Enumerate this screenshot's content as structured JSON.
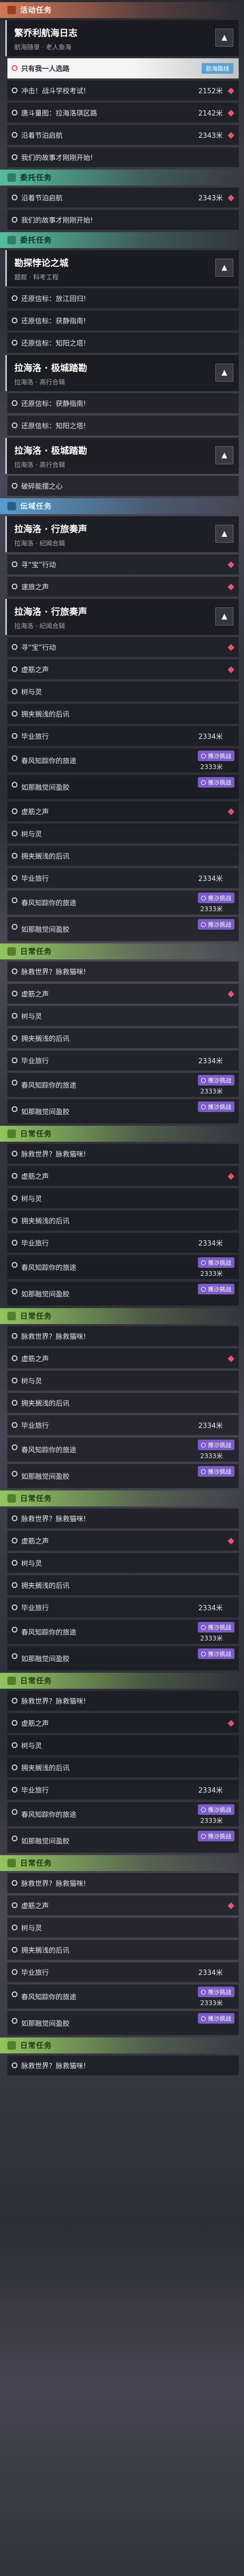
{
  "badges": {
    "navigate": "航海路线",
    "challenge": "推沙挑战"
  },
  "feed": [
    {
      "k": "sec",
      "type": "event",
      "label": "活动任务"
    },
    {
      "k": "head",
      "title": "繁乔利航海日志",
      "sub": "航海随录 · 老人鱼海"
    },
    {
      "k": "row",
      "label": "只有我一人选路",
      "hl": true,
      "badge": "航海路线"
    },
    {
      "k": "row",
      "label": "冲击！战斗学校考试!",
      "dist": "2152米",
      "pin": true
    },
    {
      "k": "row",
      "label": "唐斗量图：拉海洛琪区路",
      "dist": "2142米",
      "pin": true
    },
    {
      "k": "row",
      "label": "沿着节泊启航",
      "dist": "2343米",
      "pin": true
    },
    {
      "k": "row",
      "label": "我们的故事才刚刚开始!"
    },
    {
      "k": "sec",
      "type": "comm",
      "label": "委托任务"
    },
    {
      "k": "row",
      "label": "沿着节泊启航",
      "dist": "2343米",
      "pin": true
    },
    {
      "k": "row",
      "label": "我们的故事才刚刚开始!"
    },
    {
      "k": "sec",
      "type": "comm",
      "label": "委托任务"
    },
    {
      "k": "head",
      "title": "勘探悖论之城",
      "sub": "题叙 · 科考工程"
    },
    {
      "k": "row",
      "label": "还原信标：放江回归!"
    },
    {
      "k": "row",
      "label": "还原信标：获静指南!"
    },
    {
      "k": "row",
      "label": "还原信标：知阳之塔!"
    },
    {
      "k": "head",
      "title": "拉海洛 · 极城踏勘",
      "sub": "拉海洛 · 高行合辑"
    },
    {
      "k": "row",
      "label": "还原信标：获静指南!"
    },
    {
      "k": "row",
      "label": "还原信标：知阳之塔!"
    },
    {
      "k": "head",
      "title": "拉海洛 · 极城踏勘",
      "sub": "拉海洛 · 高行合辑"
    },
    {
      "k": "row",
      "label": "破碎能摆之心"
    },
    {
      "k": "sec",
      "type": "invite",
      "label": "伝域任务"
    },
    {
      "k": "head",
      "title": "拉海洛 · 行旅奏声",
      "sub": "拉海洛 · 纪闻合辑"
    },
    {
      "k": "row",
      "label": "寻“宝”行动",
      "pin": true
    },
    {
      "k": "row",
      "label": "速旅之声",
      "pin": true
    },
    {
      "k": "head",
      "title": "拉海洛 · 行旅奏声",
      "sub": "拉海洛 · 纪闻合辑"
    },
    {
      "k": "row",
      "label": "寻“宝”行动",
      "pin": true
    },
    {
      "k": "row",
      "label": "虚筋之声",
      "pin": true
    },
    {
      "k": "row",
      "label": "树与灵"
    },
    {
      "k": "row",
      "label": "拥夹搁浅的后讯"
    },
    {
      "k": "row",
      "label": "毕业旅行",
      "dist": "2334米"
    },
    {
      "k": "row",
      "label": "春风知踪你的旅途",
      "chal": true,
      "dist": "2333米"
    },
    {
      "k": "row",
      "label": "如那融觉间盈胶",
      "chal": true
    },
    {
      "k": "row",
      "label": "虚筋之声",
      "pin": true
    },
    {
      "k": "row",
      "label": "树与灵"
    },
    {
      "k": "row",
      "label": "拥夹搁浅的后讯"
    },
    {
      "k": "row",
      "label": "毕业旅行",
      "dist": "2334米"
    },
    {
      "k": "row",
      "label": "春风知踪你的旅途",
      "chal": true,
      "dist": "2333米"
    },
    {
      "k": "row",
      "label": "如那融觉间盈胶",
      "chal": true
    },
    {
      "k": "sec",
      "type": "daily",
      "label": "日常任务"
    },
    {
      "k": "row",
      "label": "脉救世界？脉救猫咪!"
    },
    {
      "k": "row",
      "label": "虚筋之声",
      "pin": true
    },
    {
      "k": "row",
      "label": "树与灵"
    },
    {
      "k": "row",
      "label": "拥夹搁浅的后讯"
    },
    {
      "k": "row",
      "label": "毕业旅行",
      "dist": "2334米"
    },
    {
      "k": "row",
      "label": "春风知踪你的旅途",
      "chal": true,
      "dist": "2333米"
    },
    {
      "k": "row",
      "label": "如那融觉间盈胶",
      "chal": true
    },
    {
      "k": "sec",
      "type": "daily",
      "label": "日常任务"
    },
    {
      "k": "row",
      "label": "脉救世界？脉救猫咪!"
    },
    {
      "k": "row",
      "label": "虚筋之声",
      "pin": true
    },
    {
      "k": "row",
      "label": "树与灵"
    },
    {
      "k": "row",
      "label": "拥夹搁浅的后讯"
    },
    {
      "k": "row",
      "label": "毕业旅行",
      "dist": "2334米"
    },
    {
      "k": "row",
      "label": "春风知踪你的旅途",
      "chal": true,
      "dist": "2333米"
    },
    {
      "k": "row",
      "label": "如那融觉间盈胶",
      "chal": true
    },
    {
      "k": "sec",
      "type": "daily",
      "label": "日常任务"
    },
    {
      "k": "row",
      "label": "脉救世界？脉救猫咪!"
    },
    {
      "k": "row",
      "label": "虚筋之声",
      "pin": true
    },
    {
      "k": "row",
      "label": "树与灵"
    },
    {
      "k": "row",
      "label": "拥夹搁浅的后讯"
    },
    {
      "k": "row",
      "label": "毕业旅行",
      "dist": "2334米"
    },
    {
      "k": "row",
      "label": "春风知踪你的旅途",
      "chal": true,
      "dist": "2333米"
    },
    {
      "k": "row",
      "label": "如那融觉间盈胶",
      "chal": true
    },
    {
      "k": "sec",
      "type": "daily",
      "label": "日常任务"
    },
    {
      "k": "row",
      "label": "脉救世界？脉救猫咪!"
    },
    {
      "k": "row",
      "label": "虚筋之声",
      "pin": true
    },
    {
      "k": "row",
      "label": "树与灵"
    },
    {
      "k": "row",
      "label": "拥夹搁浅的后讯"
    },
    {
      "k": "row",
      "label": "毕业旅行",
      "dist": "2334米"
    },
    {
      "k": "row",
      "label": "春风知踪你的旅途",
      "chal": true,
      "dist": "2333米"
    },
    {
      "k": "row",
      "label": "如那融觉间盈胶",
      "chal": true
    },
    {
      "k": "sec",
      "type": "daily",
      "label": "日常任务"
    },
    {
      "k": "row",
      "label": "脉救世界？脉救猫咪!"
    },
    {
      "k": "row",
      "label": "虚筋之声",
      "pin": true
    },
    {
      "k": "row",
      "label": "树与灵"
    },
    {
      "k": "row",
      "label": "拥夹搁浅的后讯"
    },
    {
      "k": "row",
      "label": "毕业旅行",
      "dist": "2334米"
    },
    {
      "k": "row",
      "label": "春风知踪你的旅途",
      "chal": true,
      "dist": "2333米"
    },
    {
      "k": "row",
      "label": "如那融觉间盈胶",
      "chal": true
    },
    {
      "k": "sec",
      "type": "daily",
      "label": "日常任务"
    },
    {
      "k": "row",
      "label": "脉救世界？脉救猫咪!"
    },
    {
      "k": "row",
      "label": "虚筋之声",
      "pin": true
    },
    {
      "k": "row",
      "label": "树与灵"
    },
    {
      "k": "row",
      "label": "拥夹搁浅的后讯"
    },
    {
      "k": "row",
      "label": "毕业旅行",
      "dist": "2334米"
    },
    {
      "k": "row",
      "label": "春风知踪你的旅途",
      "chal": true,
      "dist": "2333米"
    },
    {
      "k": "row",
      "label": "如那融觉间盈胶",
      "chal": true
    },
    {
      "k": "sec",
      "type": "daily",
      "label": "日常任务"
    },
    {
      "k": "row",
      "label": "脉救世界？脉救猫咪!"
    }
  ]
}
